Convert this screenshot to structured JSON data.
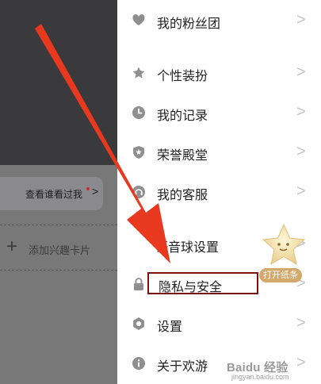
{
  "background": {
    "visitor_label": "查看谁看过我",
    "add_card_label": "添加兴趣卡片"
  },
  "menu": {
    "items": [
      {
        "label": "我的粉丝团",
        "icon": "heart-icon"
      },
      {
        "label": "个性装扮",
        "icon": "star-icon"
      },
      {
        "label": "我的记录",
        "icon": "clock-icon"
      },
      {
        "label": "荣誉殿堂",
        "icon": "shield-star-icon"
      },
      {
        "label": "我的客服",
        "icon": "headset-icon"
      },
      {
        "label": "语音球设置",
        "icon": "voice-ball-icon"
      },
      {
        "label": "隐私与安全",
        "icon": "lock-icon"
      },
      {
        "label": "设置",
        "icon": "gear-icon"
      },
      {
        "label": "关于欢游",
        "icon": "info-icon"
      }
    ],
    "chevron": ">"
  },
  "floating": {
    "tag_label": "打开纸条"
  },
  "watermark": {
    "text": "Baidu 经验",
    "sub": "jingyan.baidu.com"
  },
  "colors": {
    "arrow": "#e8391e",
    "highlight_box": "#7a1212",
    "icon": "#8e8e93"
  }
}
